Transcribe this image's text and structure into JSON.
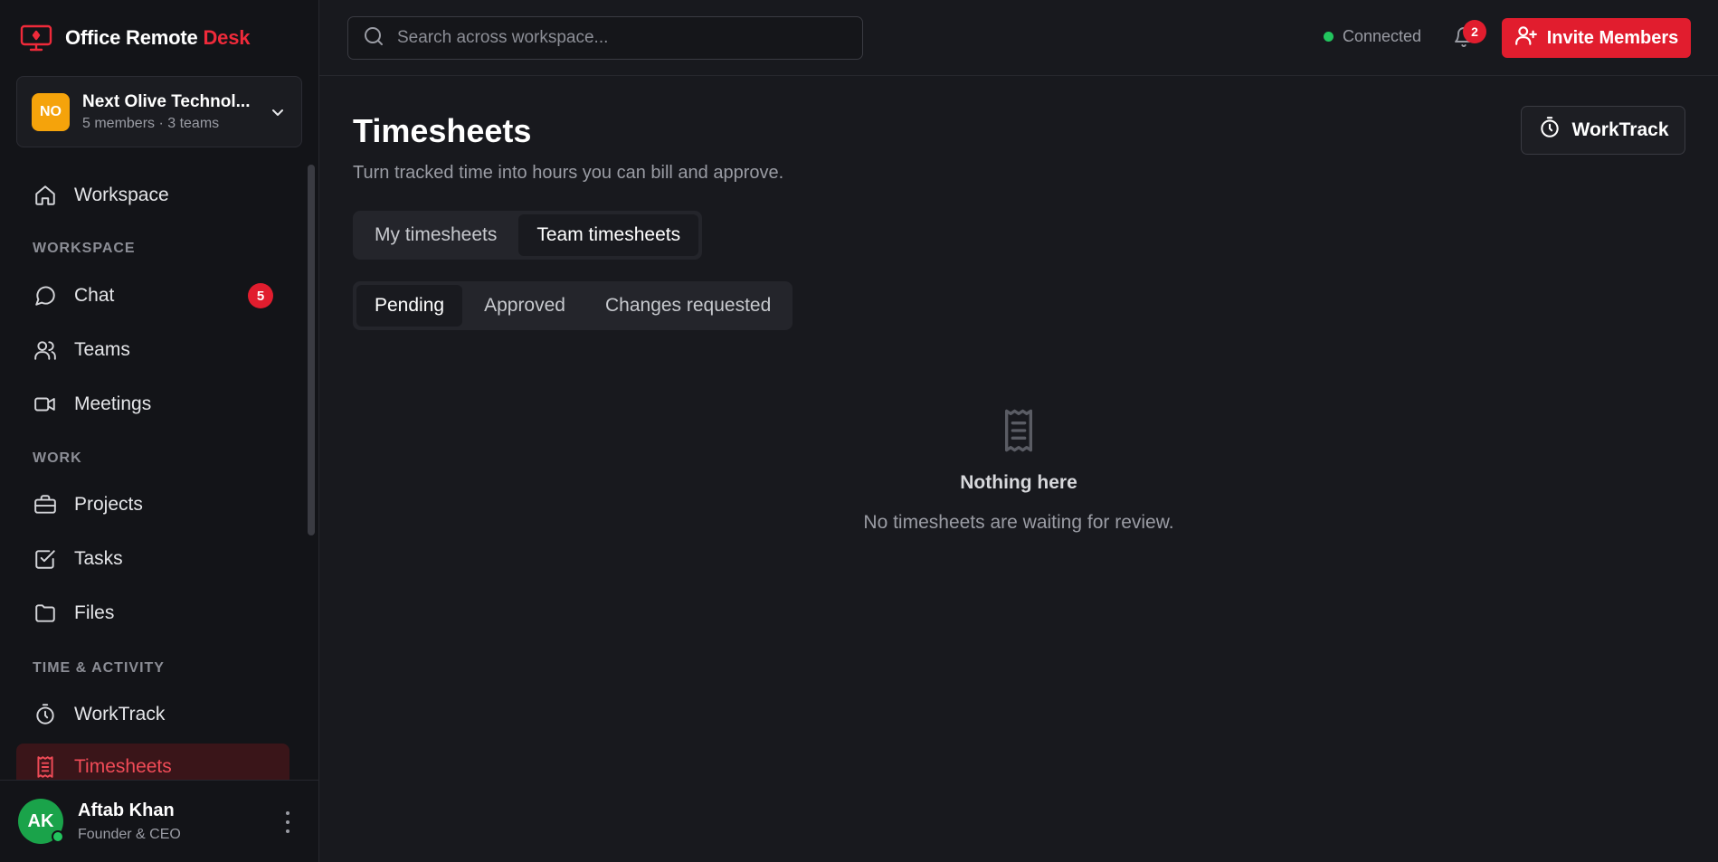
{
  "brand": {
    "name": "Office Remote",
    "accent": "Desk"
  },
  "org": {
    "initials": "NO",
    "name": "Next Olive Technol...",
    "meta": "5 members · 3 teams"
  },
  "sidebar": {
    "home": {
      "label": "Workspace",
      "icon": "home-icon"
    },
    "sections": {
      "workspace": "WORKSPACE",
      "work": "WORK",
      "time": "TIME & ACTIVITY"
    },
    "items": {
      "chat": {
        "label": "Chat",
        "badge": "5",
        "icon": "chat-icon"
      },
      "teams": {
        "label": "Teams",
        "icon": "users-icon"
      },
      "meetings": {
        "label": "Meetings",
        "icon": "video-icon"
      },
      "projects": {
        "label": "Projects",
        "icon": "briefcase-icon"
      },
      "tasks": {
        "label": "Tasks",
        "icon": "checkbox-icon"
      },
      "files": {
        "label": "Files",
        "icon": "folder-icon"
      },
      "worktrack": {
        "label": "WorkTrack",
        "icon": "timer-icon"
      },
      "timesheets": {
        "label": "Timesheets",
        "icon": "receipt-icon",
        "active": true
      }
    }
  },
  "user": {
    "initials": "AK",
    "name": "Aftab Khan",
    "role": "Founder & CEO",
    "online": true
  },
  "topbar": {
    "search_placeholder": "Search across workspace...",
    "status": "Connected",
    "notifications": "2",
    "invite_label": "Invite Members"
  },
  "page": {
    "title": "Timesheets",
    "subtitle": "Turn tracked time into hours you can bill and approve.",
    "worktrack_label": "WorkTrack",
    "scope_tabs": [
      {
        "label": "My timesheets",
        "active": false
      },
      {
        "label": "Team timesheets",
        "active": true
      }
    ],
    "status_tabs": [
      {
        "label": "Pending",
        "active": true
      },
      {
        "label": "Approved",
        "active": false
      },
      {
        "label": "Changes requested",
        "active": false
      }
    ],
    "empty": {
      "title": "Nothing here",
      "description": "No timesheets are waiting for review."
    }
  },
  "colors": {
    "accent": "#e11d2e",
    "background": "#18191e",
    "sidebar": "#131418",
    "online": "#22c55e",
    "org_avatar": "#f5a30b",
    "user_avatar": "#1aa34a"
  }
}
